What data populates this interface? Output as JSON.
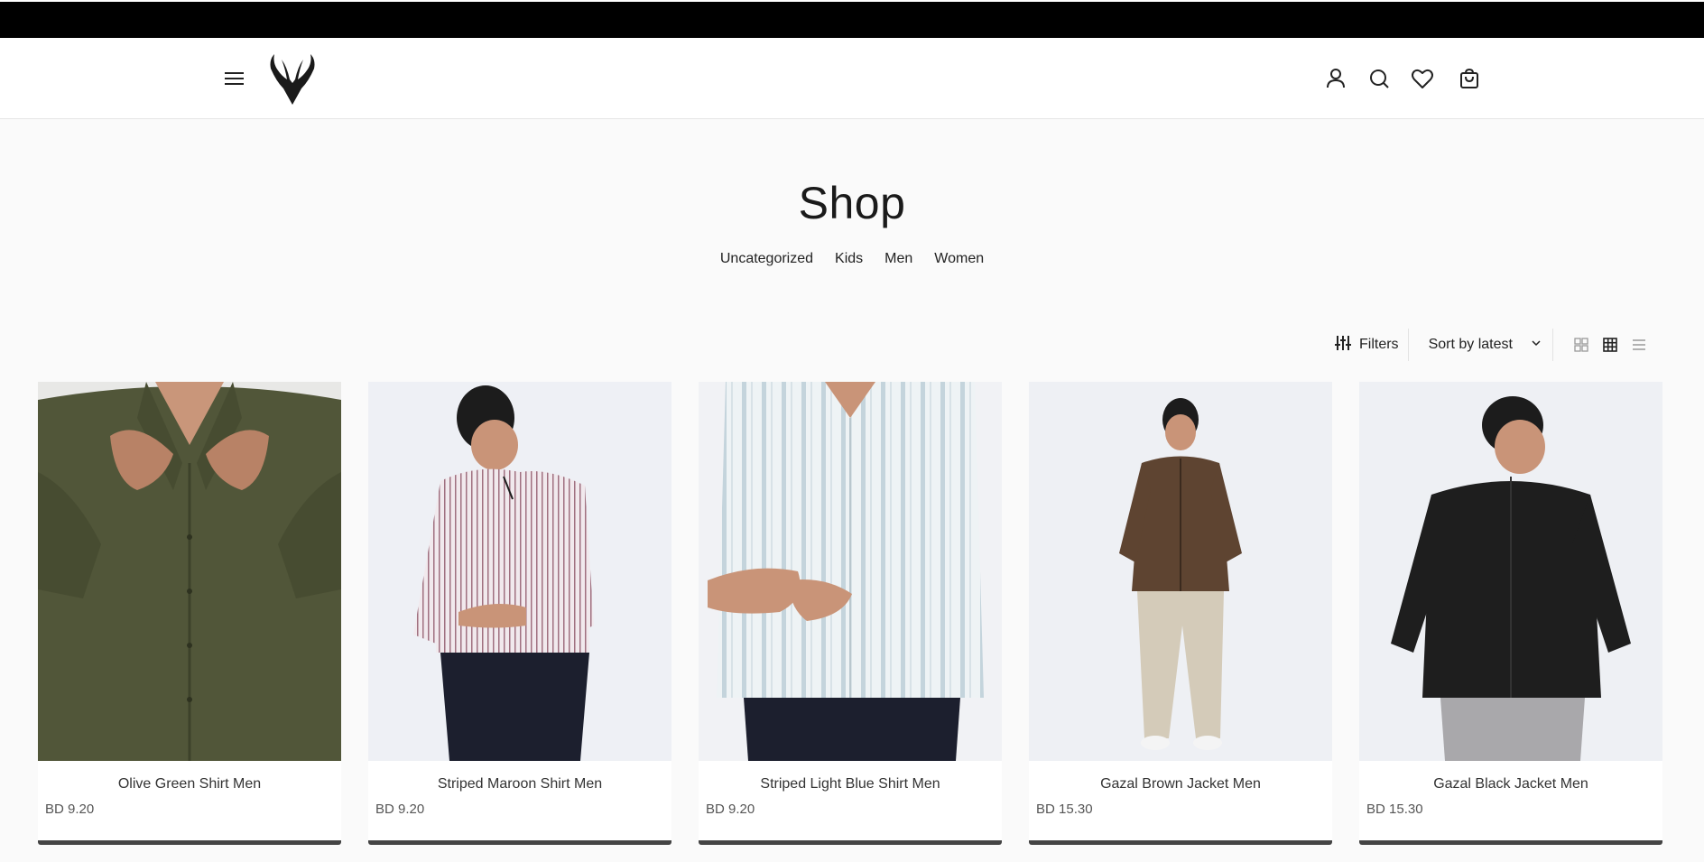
{
  "header": {
    "menu_icon": "hamburger-menu-icon",
    "logo": "gazelle-antler-logo",
    "icons": [
      "user-account-icon",
      "search-icon",
      "heart-wishlist-icon",
      "shopping-bag-icon"
    ]
  },
  "page": {
    "title": "Shop",
    "categories": [
      "Uncategorized",
      "Kids",
      "Men",
      "Women"
    ]
  },
  "toolbar": {
    "filters_label": "Filters",
    "sort_label": "Sort by latest",
    "views": [
      "grid-small-icon",
      "grid-large-icon",
      "list-view-icon"
    ],
    "active_view": "grid-large-icon"
  },
  "products": [
    {
      "name": "Olive Green Shirt Men",
      "price": "BD 9.20",
      "color": "#4f5438"
    },
    {
      "name": "Striped Maroon Shirt Men",
      "price": "BD 9.20",
      "color": "#e9dfe4"
    },
    {
      "name": "Striped Light Blue Shirt Men",
      "price": "BD 9.20",
      "color": "#dfe9ee"
    },
    {
      "name": "Gazal Brown Jacket Men",
      "price": "BD 15.30",
      "color": "#5e4431"
    },
    {
      "name": "Gazal Black Jacket Men",
      "price": "BD 15.30",
      "color": "#1e1e1e"
    }
  ]
}
